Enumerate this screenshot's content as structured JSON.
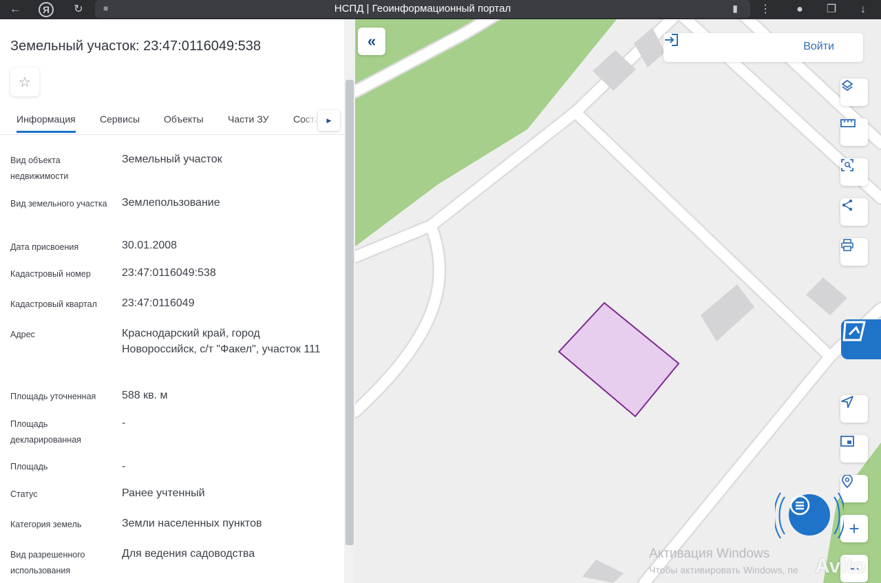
{
  "browser": {
    "title": "НСПД | Геоинформационный портал"
  },
  "panel": {
    "title": "Земельный участок: 23:47:0116049:538",
    "tabs": [
      "Информация",
      "Сервисы",
      "Объекты",
      "Части ЗУ",
      "Соста"
    ],
    "active_tab": "Информация",
    "rows": [
      {
        "label": "Вид объекта недвижимости",
        "value": "Земельный участок"
      },
      {
        "label": "Вид земельного участка",
        "value": "Землепользование"
      },
      {
        "label": "Дата присвоения",
        "value": "30.01.2008"
      },
      {
        "label": "Кадастровый номер",
        "value": "23:47:0116049:538"
      },
      {
        "label": "Кадастровый квартал",
        "value": "23:47:0116049"
      },
      {
        "label": "Адрес",
        "value": "Краснодарский край, город Новороссийск, с/т \"Факел\", участок 111"
      },
      {
        "label": "Площадь уточненная",
        "value": "588 кв. м"
      },
      {
        "label": "Площадь декларированная",
        "value": "-"
      },
      {
        "label": "Площадь",
        "value": "-"
      },
      {
        "label": "Статус",
        "value": "Ранее учтенный"
      },
      {
        "label": "Категория земель",
        "value": "Земли населенных пунктов"
      },
      {
        "label": "Вид разрешенного использования",
        "value": "Для ведения садоводства"
      }
    ]
  },
  "map": {
    "login_label": "Войти",
    "watermark_title": "Активация Windows",
    "watermark_sub": "Чтобы активировать Windows, пе",
    "avito": "Avito",
    "colors": {
      "background": "#eeeeef",
      "green": "#a5cf8a",
      "parcel_fill": "#e7cdee",
      "parcel_stroke": "#7d2a8f",
      "building": "#d4d4d6",
      "accent": "#1f73c8"
    }
  }
}
